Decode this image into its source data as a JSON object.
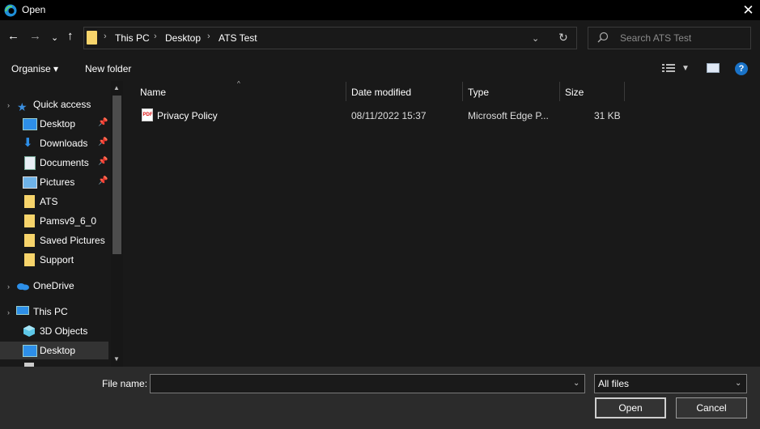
{
  "window": {
    "title": "Open",
    "close_glyph": "✕"
  },
  "nav": {
    "back_glyph": "←",
    "forward_glyph": "→",
    "recent_glyph": "⌄",
    "up_glyph": "↑",
    "breadcrumb": [
      "This PC",
      "Desktop",
      "ATS Test"
    ],
    "breadcrumb_sep": "›",
    "refresh_glyph": "↻",
    "dropdown_glyph": "⌄",
    "search_placeholder": "Search ATS Test"
  },
  "toolbar": {
    "organise_label": "Organise ▾",
    "new_folder_label": "New folder",
    "help_glyph": "?"
  },
  "sidebar": {
    "quick_access": "Quick access",
    "items": [
      {
        "label": "Desktop",
        "pinned": true,
        "icon": "desktop-icon"
      },
      {
        "label": "Downloads",
        "pinned": true,
        "icon": "download-icon"
      },
      {
        "label": "Documents",
        "pinned": true,
        "icon": "documents-icon"
      },
      {
        "label": "Pictures",
        "pinned": true,
        "icon": "pictures-icon"
      },
      {
        "label": "ATS",
        "icon": "folder-icon"
      },
      {
        "label": "Pamsv9_6_0",
        "icon": "folder-icon"
      },
      {
        "label": "Saved Pictures",
        "icon": "folder-icon"
      },
      {
        "label": "Support",
        "icon": "folder-icon"
      }
    ],
    "onedrive": "OneDrive",
    "this_pc": "This PC",
    "pc_items": [
      {
        "label": "3D Objects",
        "icon": "3d-objects-icon"
      },
      {
        "label": "Desktop",
        "icon": "desktop-icon",
        "selected": true
      }
    ]
  },
  "file_list": {
    "columns": [
      "Name",
      "Date modified",
      "Type",
      "Size"
    ],
    "rows": [
      {
        "name": "Privacy Policy",
        "date": "08/11/2022 15:37",
        "type": "Microsoft Edge P...",
        "size": "31 KB",
        "icon": "pdf-icon",
        "icon_text": "PDF"
      }
    ]
  },
  "bottom": {
    "file_name_label": "File name:",
    "file_name_value": "",
    "file_type_value": "All files",
    "open_label": "Open",
    "cancel_label": "Cancel"
  },
  "colors": {
    "background": "#191919",
    "titlebar": "#000000",
    "footer": "#2b2b2b",
    "folder": "#f7d46b",
    "accent": "#1a73c8"
  }
}
